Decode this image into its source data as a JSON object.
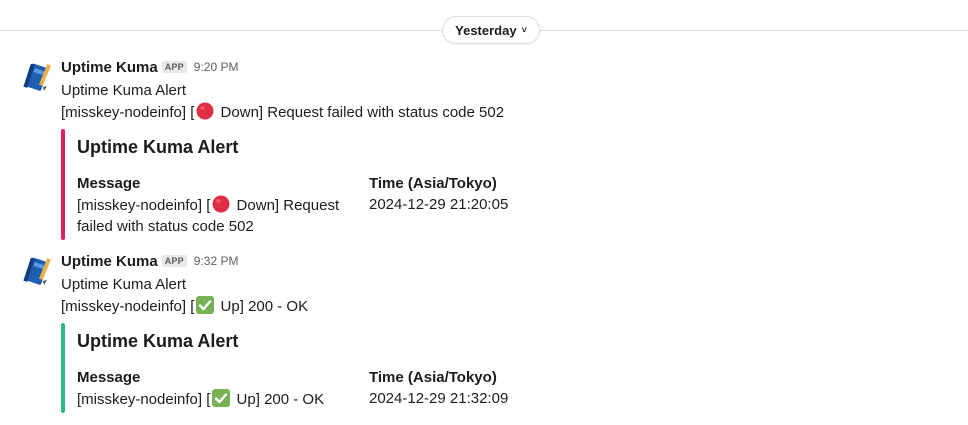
{
  "date_divider": {
    "label": "Yesterday"
  },
  "messages": [
    {
      "sender": "Uptime Kuma",
      "badge": "APP",
      "time": "9:20 PM",
      "line1": "Uptime Kuma Alert",
      "line2_prefix": "[misskey-nodeinfo] [",
      "status_emoji": "red-circle-icon",
      "line2_suffix": " Down] Request failed with status code 502",
      "accent_color": "#e01e5a",
      "attachment": {
        "title": "Uptime Kuma Alert",
        "message_label": "Message",
        "message_prefix": "[misskey-nodeinfo] [",
        "message_suffix": " Down] Request failed with status code 502",
        "time_label": "Time (Asia/Tokyo)",
        "time_value": "2024-12-29 21:20:05"
      }
    },
    {
      "sender": "Uptime Kuma",
      "badge": "APP",
      "time": "9:32 PM",
      "line1": "Uptime Kuma Alert",
      "line2_prefix": "[misskey-nodeinfo] [",
      "status_emoji": "check-mark-icon",
      "line2_suffix": " Up] 200 - OK",
      "accent_color": "#2eb67d",
      "attachment": {
        "title": "Uptime Kuma Alert",
        "message_label": "Message",
        "message_prefix": "[misskey-nodeinfo] [",
        "message_suffix": " Up] 200 - OK",
        "time_label": "Time (Asia/Tokyo)",
        "time_value": "2024-12-29 21:32:09"
      }
    }
  ]
}
